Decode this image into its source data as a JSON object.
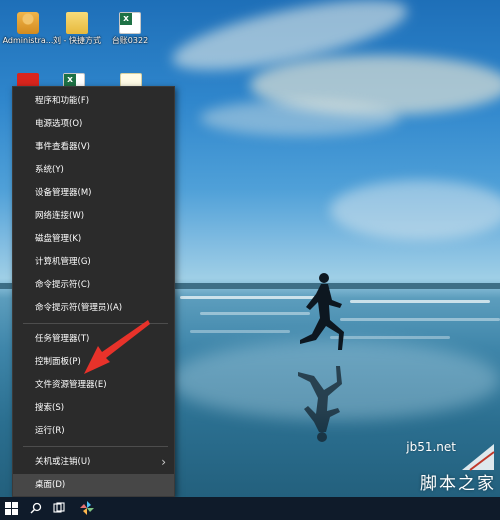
{
  "desktop_icons": [
    {
      "label": "Administra...",
      "icon": "user-folder-icon"
    },
    {
      "label": "刘 - 快捷方式",
      "icon": "folder-shortcut-icon"
    },
    {
      "label": "台账0322",
      "icon": "excel-file-icon"
    }
  ],
  "context_menu": {
    "items": [
      {
        "label": "程序和功能(F)"
      },
      {
        "label": "电源选项(O)"
      },
      {
        "label": "事件查看器(V)"
      },
      {
        "label": "系统(Y)"
      },
      {
        "label": "设备管理器(M)"
      },
      {
        "label": "网络连接(W)"
      },
      {
        "label": "磁盘管理(K)"
      },
      {
        "label": "计算机管理(G)"
      },
      {
        "label": "命令提示符(C)"
      },
      {
        "label": "命令提示符(管理员)(A)"
      },
      {
        "label": "任务管理器(T)"
      },
      {
        "label": "控制面板(P)"
      },
      {
        "label": "文件资源管理器(E)"
      },
      {
        "label": "搜索(S)"
      },
      {
        "label": "运行(R)"
      },
      {
        "label": "关机或注销(U)",
        "has_submenu": true
      },
      {
        "label": "桌面(D)"
      }
    ],
    "chevron": "›"
  },
  "taskbar": {
    "icons": [
      "windows-start-icon",
      "search-icon",
      "task-view-icon",
      "pinwheel-icon"
    ]
  },
  "watermark": {
    "site": "jb51.net",
    "name": "脚本之家"
  },
  "colors": {
    "menu_bg": "#2b2b2b",
    "arrow": "#e8322a",
    "taskbar": "#0f1b2a"
  }
}
